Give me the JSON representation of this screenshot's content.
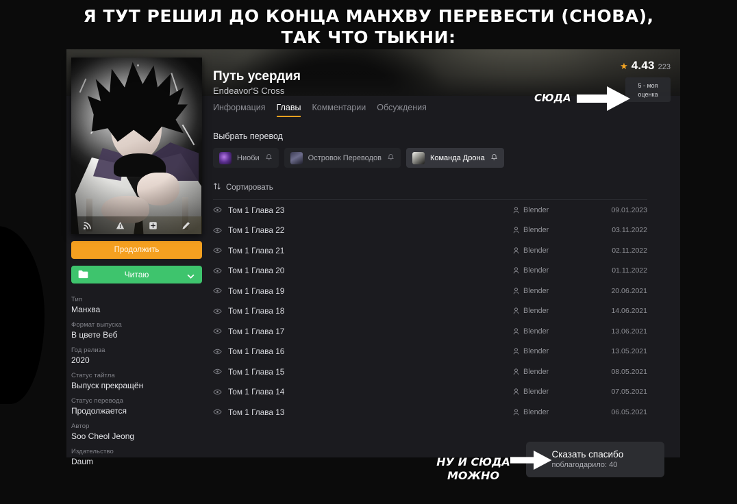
{
  "meme": {
    "caption_line1": "Я тут решил до конца манхву перевести (снова),",
    "caption_line2": "так что тыкни:",
    "anno_top": "СЮДА",
    "anno_bottom_line1": "Ну и сюда",
    "anno_bottom_line2": "можно"
  },
  "title": {
    "main": "Путь усердия",
    "alt": "Endeavor'S Cross"
  },
  "rating": {
    "star_icon": "star-icon",
    "value": "4.43",
    "votes": "223",
    "my_rating_line1": "5 - моя",
    "my_rating_line2": "оценка"
  },
  "cover": {
    "tools": [
      {
        "name": "rss-icon",
        "label": "RSS"
      },
      {
        "name": "report-icon",
        "label": "Пожаловаться"
      },
      {
        "name": "add-to-list-icon",
        "label": "Добавить"
      },
      {
        "name": "edit-icon",
        "label": "Редактировать"
      }
    ]
  },
  "buttons": {
    "continue": "Продолжить",
    "bookmark": "Читаю",
    "bookmark_folder_icon": "folder-icon",
    "bookmark_chevron_icon": "chevron-down-icon",
    "continue_color": "#f5a020",
    "bookmark_color": "#3ec46d"
  },
  "info": [
    {
      "key": "Тип",
      "value": "Манхва"
    },
    {
      "key": "Формат выпуска",
      "value": "В цвете   Веб"
    },
    {
      "key": "Год релиза",
      "value": "2020"
    },
    {
      "key": "Статус тайтла",
      "value": "Выпуск прекращён"
    },
    {
      "key": "Статус перевода",
      "value": "Продолжается"
    },
    {
      "key": "Автор",
      "value": "Soo Cheol Jeong"
    },
    {
      "key": "Издательство",
      "value": "Daum"
    }
  ],
  "tabs": [
    {
      "label": "Информация",
      "active": false
    },
    {
      "label": "Главы",
      "active": true
    },
    {
      "label": "Комментарии",
      "active": false
    },
    {
      "label": "Обсуждения",
      "active": false
    }
  ],
  "translations": {
    "section_title": "Выбрать перевод",
    "teams": [
      {
        "name": "Ниоби",
        "active": false,
        "bell_icon": "bell-icon"
      },
      {
        "name": "Островок Переводов",
        "active": false,
        "bell_icon": "bell-icon"
      },
      {
        "name": "Команда Дрона",
        "active": true,
        "bell_icon": "bell-icon"
      }
    ]
  },
  "chapters": {
    "sort_label": "Сортировать",
    "sort_icon": "sort-arrows-icon",
    "rows": [
      {
        "title": "Том 1 Глава 23",
        "uploader": "Blender",
        "date": "09.01.2023"
      },
      {
        "title": "Том 1 Глава 22",
        "uploader": "Blender",
        "date": "03.11.2022"
      },
      {
        "title": "Том 1 Глава 21",
        "uploader": "Blender",
        "date": "02.11.2022"
      },
      {
        "title": "Том 1 Глава 20",
        "uploader": "Blender",
        "date": "01.11.2022"
      },
      {
        "title": "Том 1 Глава 19",
        "uploader": "Blender",
        "date": "20.06.2021"
      },
      {
        "title": "Том 1 Глава 18",
        "uploader": "Blender",
        "date": "14.06.2021"
      },
      {
        "title": "Том 1 Глава 17",
        "uploader": "Blender",
        "date": "13.06.2021"
      },
      {
        "title": "Том 1 Глава 16",
        "uploader": "Blender",
        "date": "13.05.2021"
      },
      {
        "title": "Том 1 Глава 15",
        "uploader": "Blender",
        "date": "08.05.2021"
      },
      {
        "title": "Том 1 Глава 14",
        "uploader": "Blender",
        "date": "07.05.2021"
      },
      {
        "title": "Том 1 Глава 13",
        "uploader": "Blender",
        "date": "06.05.2021"
      }
    ]
  },
  "thanks": {
    "heart_icon": "heart-icon",
    "label": "Сказать спасибо",
    "count_label": "поблагодарило: 40"
  }
}
